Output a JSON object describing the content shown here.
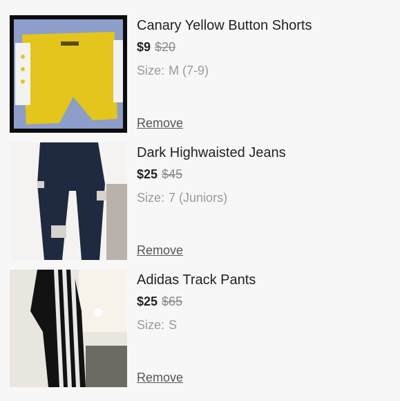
{
  "items": [
    {
      "title": "Canary Yellow Button Shorts",
      "price": "$9",
      "original_price": "$20",
      "size_label": "Size:",
      "size_value": "M (7-9)",
      "remove_label": "Remove"
    },
    {
      "title": "Dark Highwaisted Jeans",
      "price": "$25",
      "original_price": "$45",
      "size_label": "Size:",
      "size_value": "7 (Juniors)",
      "remove_label": "Remove"
    },
    {
      "title": "Adidas Track Pants",
      "price": "$25",
      "original_price": "$65",
      "size_label": "Size:",
      "size_value": "S",
      "remove_label": "Remove"
    }
  ]
}
